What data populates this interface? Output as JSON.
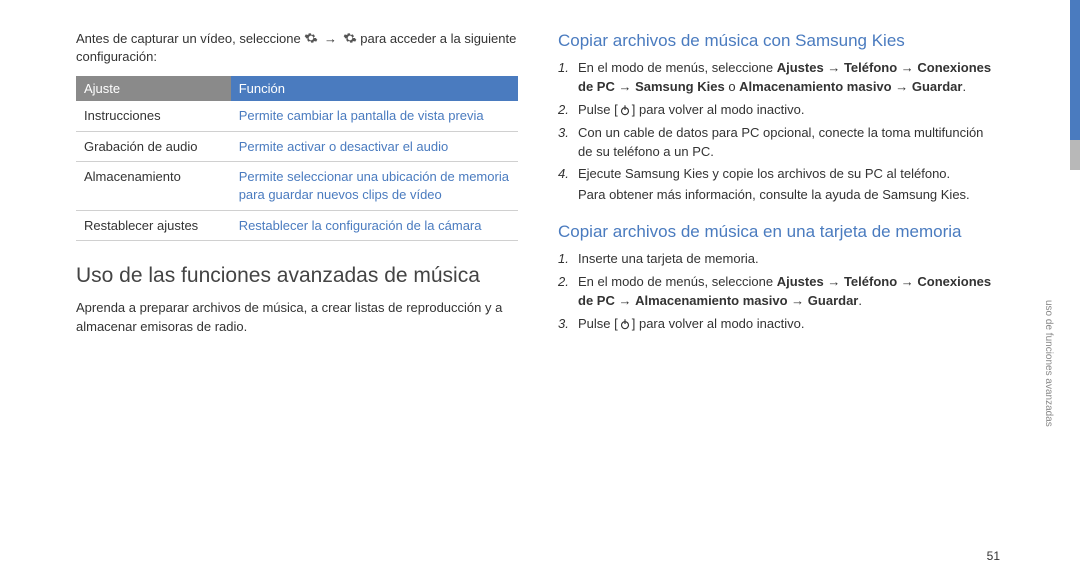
{
  "intro": {
    "pre_text": "Antes de capturar un vídeo, seleccione ",
    "mid_text": " para acceder a la siguiente configuración:"
  },
  "arrow": "→",
  "table": {
    "header_setting": "Ajuste",
    "header_function": "Función",
    "rows": [
      {
        "setting": "Instrucciones",
        "function": "Permite cambiar la pantalla de vista previa"
      },
      {
        "setting": "Grabación de audio",
        "function": "Permite activar o desactivar el audio"
      },
      {
        "setting": "Almacenamiento",
        "function": "Permite seleccionar una ubicación de memoria para guardar nuevos clips de vídeo"
      },
      {
        "setting": "Restablecer ajustes",
        "function": "Restablecer la configuración de la cámara"
      }
    ]
  },
  "main_heading": "Uso de las funciones avanzadas de música",
  "main_para": "Aprenda a preparar archivos de música, a crear listas de reproducción y a almacenar emisoras de radio.",
  "section_kies": {
    "heading": "Copiar archivos de música con Samsung Kies",
    "step1_a": "En el modo de menús, seleccione ",
    "step1_bold1": "Ajustes",
    "step1_bold2": "Teléfono",
    "step1_bold3": "Conexiones de PC",
    "step1_bold4": "Samsung Kies",
    "step1_or": " o ",
    "step1_bold5": "Almacenamiento masivo",
    "step1_bold6": "Guardar",
    "step2_a": "Pulse [",
    "step2_b": "] para volver al modo inactivo.",
    "step3": "Con un cable de datos para PC opcional, conecte la toma multifunción de su teléfono a un PC.",
    "step4": "Ejecute Samsung Kies y copie los archivos de su PC al teléfono.",
    "step4_note": "Para obtener más información, consulte la ayuda de Samsung Kies."
  },
  "section_mem": {
    "heading": "Copiar archivos de música en una tarjeta de memoria",
    "step1": "Inserte una tarjeta de memoria.",
    "step2_a": "En el modo de menús, seleccione ",
    "step2_bold1": "Ajustes",
    "step2_bold2": "Teléfono",
    "step2_bold3": "Conexiones de PC",
    "step2_bold4": "Almacenamiento masivo",
    "step2_bold5": "Guardar",
    "step3_a": "Pulse [",
    "step3_b": "] para volver al modo inactivo."
  },
  "side_label": "uso de funciones avanzadas",
  "page_number": "51"
}
